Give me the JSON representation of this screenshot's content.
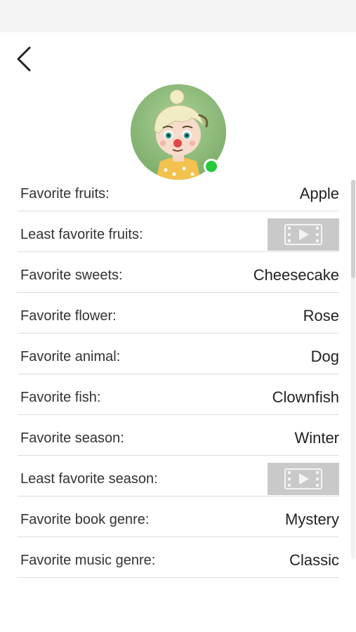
{
  "header": {
    "back_icon": "chevron-left-icon"
  },
  "profile": {
    "avatar": "cartoon-character-avatar",
    "status_color": "#27c83a"
  },
  "rows": [
    {
      "label": "Favorite fruits:",
      "value": "Apple",
      "locked": false
    },
    {
      "label": "Least favorite fruits:",
      "value": null,
      "locked": true
    },
    {
      "label": "Favorite sweets:",
      "value": "Cheesecake",
      "locked": false
    },
    {
      "label": "Favorite flower:",
      "value": "Rose",
      "locked": false
    },
    {
      "label": "Favorite animal:",
      "value": "Dog",
      "locked": false
    },
    {
      "label": "Favorite fish:",
      "value": "Clownfish",
      "locked": false
    },
    {
      "label": "Favorite season:",
      "value": "Winter",
      "locked": false
    },
    {
      "label": "Least favorite season:",
      "value": null,
      "locked": true
    },
    {
      "label": "Favorite book genre:",
      "value": "Mystery",
      "locked": false
    },
    {
      "label": "Favorite music genre:",
      "value": "Classic",
      "locked": false
    }
  ],
  "video_icon": "film-play-icon"
}
